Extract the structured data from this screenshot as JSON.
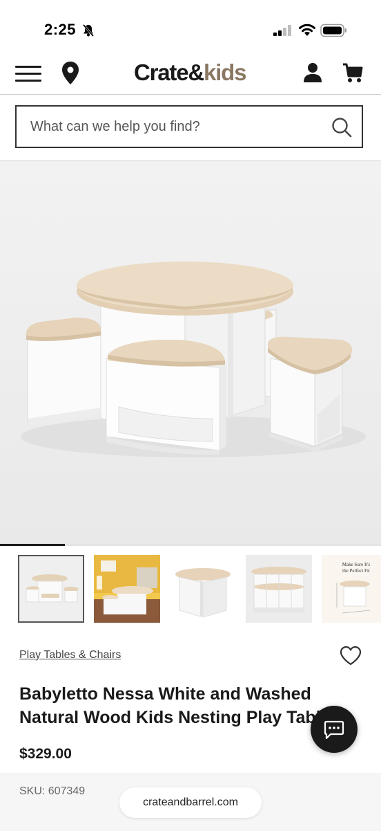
{
  "status_bar": {
    "time": "2:25"
  },
  "header": {
    "logo_crate": "Crate",
    "logo_amp": "&",
    "logo_kids": "kids",
    "icons": [
      "menu-icon",
      "location-pin-icon",
      "account-icon",
      "cart-icon"
    ]
  },
  "search": {
    "placeholder": "What can we help you find?"
  },
  "gallery": {
    "thumbnail_count": 5,
    "active_index": 0,
    "progress_fraction": 0.17,
    "thumb5_caption_line1": "Make Sure It's",
    "thumb5_caption_line2": "the Perfect Fit"
  },
  "product": {
    "category_link": "Play Tables & Chairs",
    "title": "Babyletto Nessa White and Washed Natural Wood Kids Nesting Play Table",
    "price": "$329.00",
    "sku": "SKU: 607349"
  },
  "browser": {
    "url": "crateandbarrel.com"
  },
  "colors": {
    "brand_kids": "#8a7762",
    "text": "#1a1a1a",
    "wood": "#e7d5bd"
  }
}
